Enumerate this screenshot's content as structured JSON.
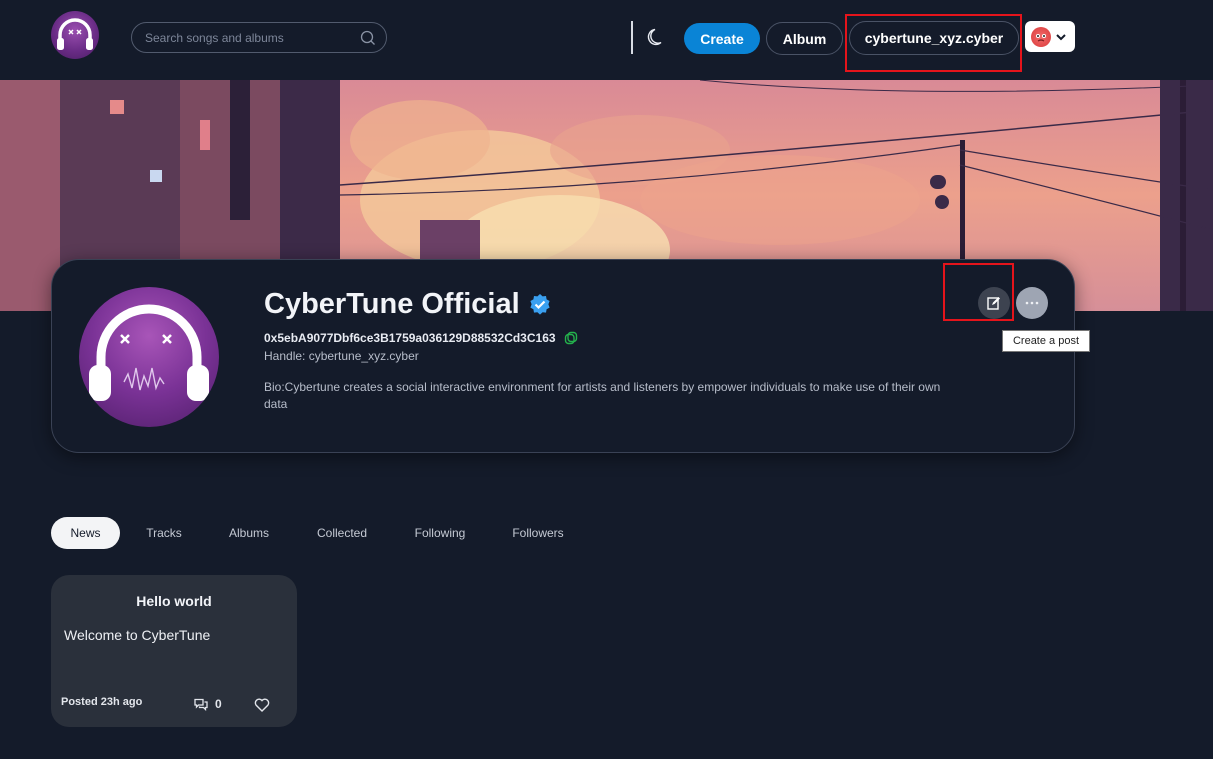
{
  "header": {
    "search_placeholder": "Search songs and albums",
    "create_label": "Create",
    "album_label": "Album",
    "username": "cybertune_xyz.cyber"
  },
  "profile": {
    "name": "CyberTune Official",
    "wallet": "0x5ebA9077Dbf6ce3B1759a036129D88532Cd3C163",
    "handle": "Handle: cybertune_xyz.cyber",
    "bio": "Bio:Cybertune creates a social interactive environment for artists and listeners by empower individuals to make use of their own data",
    "tooltip": "Create a post"
  },
  "tabs": [
    {
      "label": "News",
      "active": true
    },
    {
      "label": "Tracks",
      "active": false
    },
    {
      "label": "Albums",
      "active": false
    },
    {
      "label": "Collected",
      "active": false
    },
    {
      "label": "Following",
      "active": false
    },
    {
      "label": "Followers",
      "active": false
    }
  ],
  "post": {
    "title": "Hello world",
    "body": "Welcome to CyberTune",
    "time": "Posted 23h ago",
    "comments": "0"
  },
  "colors": {
    "background": "#141b2a",
    "accent": "#0a84d6",
    "highlight": "#e5141b",
    "verified": "#3aa0f0",
    "copy": "#24b14c"
  }
}
